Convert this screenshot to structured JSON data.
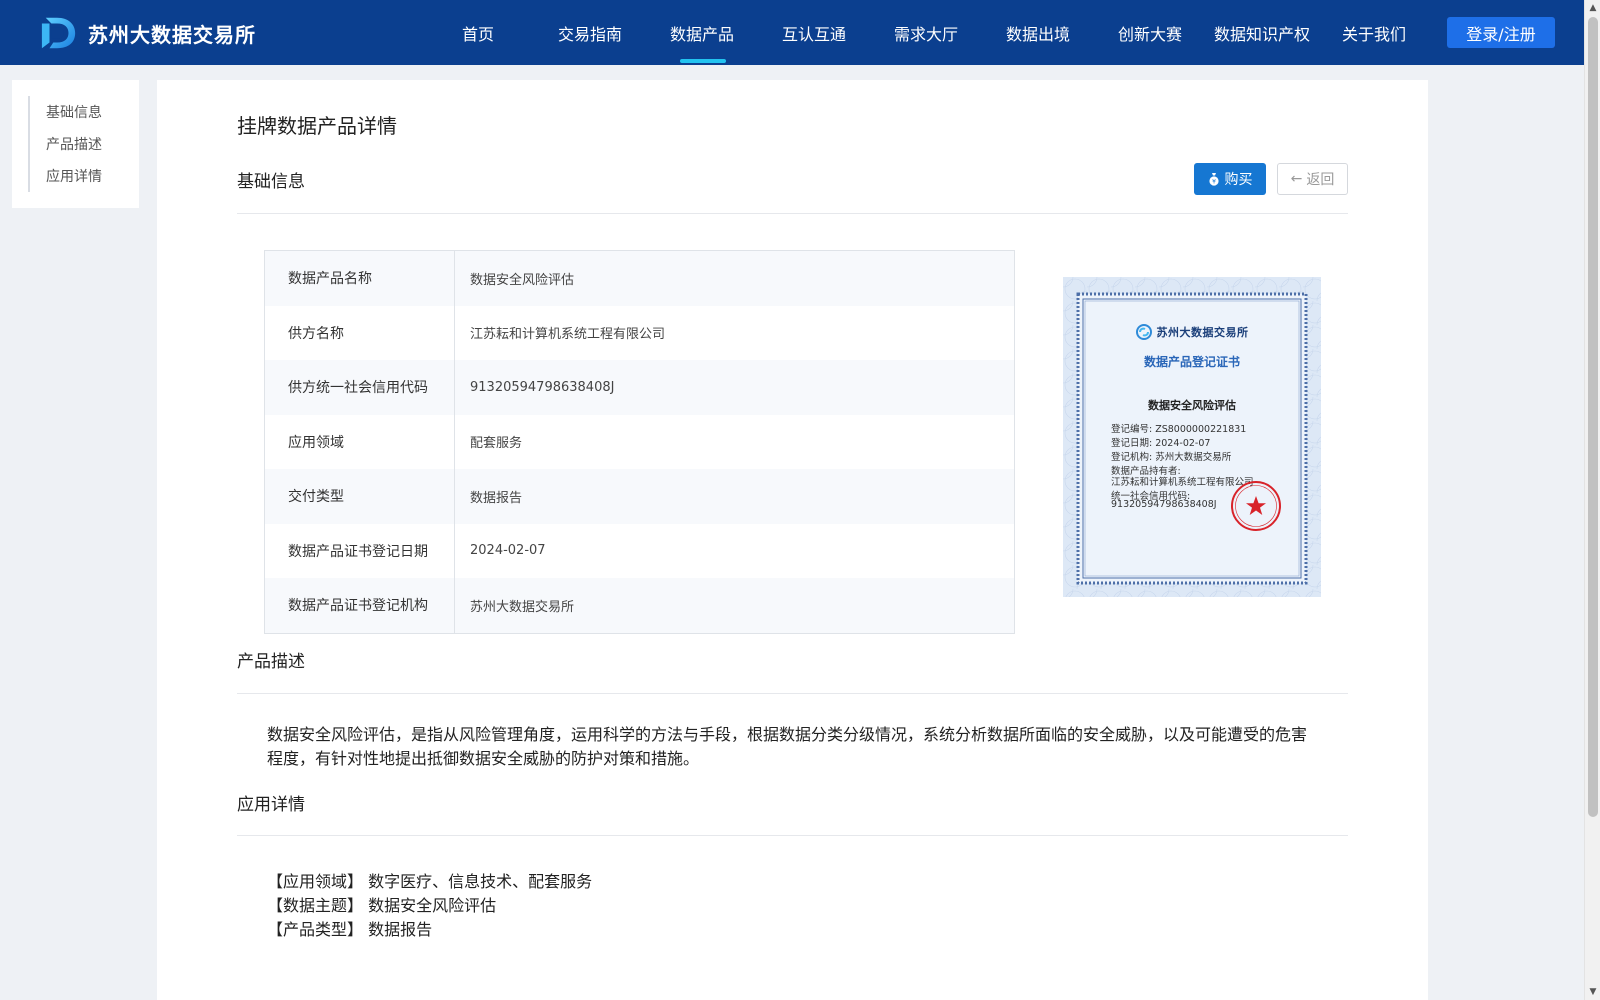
{
  "header": {
    "logo_text": "苏州大数据交易所",
    "nav": [
      {
        "label": "首页",
        "active": false
      },
      {
        "label": "交易指南",
        "active": false
      },
      {
        "label": "数据产品",
        "active": true
      },
      {
        "label": "互认互通",
        "active": false
      },
      {
        "label": "需求大厅",
        "active": false
      },
      {
        "label": "数据出境",
        "active": false
      },
      {
        "label": "创新大赛",
        "active": false
      },
      {
        "label": "数据知识产权",
        "active": false
      },
      {
        "label": "关于我们",
        "active": false
      }
    ],
    "login_label": "登录/注册"
  },
  "sidebar": {
    "items": [
      {
        "label": "基础信息"
      },
      {
        "label": "产品描述"
      },
      {
        "label": "应用详情"
      }
    ]
  },
  "main": {
    "page_title": "挂牌数据产品详情",
    "basic_section_title": "基础信息",
    "buy_label": "购买",
    "back_label": "返回",
    "info_rows": [
      {
        "key": "数据产品名称",
        "value": "数据安全风险评估"
      },
      {
        "key": "供方名称",
        "value": "江苏耘和计算机系统工程有限公司"
      },
      {
        "key": "供方统一社会信用代码",
        "value": "91320594798638408J"
      },
      {
        "key": "应用领域",
        "value": "配套服务"
      },
      {
        "key": "交付类型",
        "value": "数据报告"
      },
      {
        "key": "数据产品证书登记日期",
        "value": "2024-02-07"
      },
      {
        "key": "数据产品证书登记机构",
        "value": "苏州大数据交易所"
      }
    ],
    "certificate": {
      "org": "苏州大数据交易所",
      "title": "数据产品登记证书",
      "product": "数据安全风险评估",
      "lines": [
        "登记编号: ZS8000000221831",
        "登记日期: 2024-02-07",
        "登记机构: 苏州大数据交易所",
        "数据产品持有者:",
        "江苏耘和计算机系统工程有限公司",
        "统一社会信用代码:",
        "91320594798638408J"
      ]
    },
    "desc_section_title": "产品描述",
    "description": "数据安全风险评估，是指从风险管理角度，运用科学的方法与手段，根据数据分类分级情况，系统分析数据所面临的安全威胁，以及可能遭受的危害程度，有针对性地提出抵御数据安全威胁的防护对策和措施。",
    "app_section_title": "应用详情",
    "app_details": [
      "【应用领域】 数字医疗、信息技术、配套服务",
      "【数据主题】 数据安全风险评估",
      "【产品类型】 数据报告"
    ]
  },
  "colors": {
    "header_bg": "#0b3f8f",
    "nav_active_indicator": "#22c3f0",
    "login_button": "#1e6fe8",
    "buy_button": "#1677d2",
    "page_bg": "#eef1f5"
  }
}
